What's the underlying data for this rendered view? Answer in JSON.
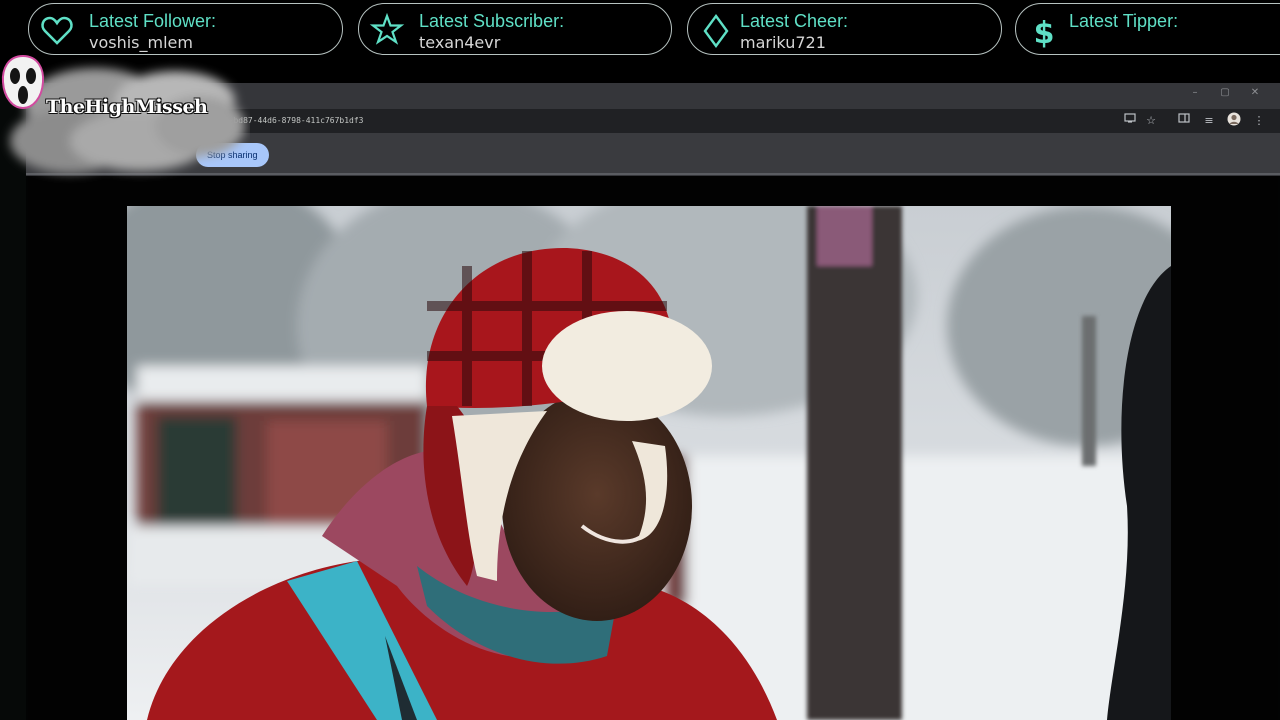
{
  "alerts": [
    {
      "icon": "heart-icon",
      "label": "Latest Follower:",
      "value": "voshis_mlem"
    },
    {
      "icon": "star-icon",
      "label": "Latest Subscriber:",
      "value": "texan4evr"
    },
    {
      "icon": "diamond-icon",
      "label": "Latest Cheer:",
      "value": "mariku721"
    },
    {
      "icon": "dollar-icon",
      "label": "Latest Tipper:",
      "value": ""
    }
  ],
  "colors": {
    "accent": "#5fe0c6",
    "pill_border": "#b6c2c0",
    "button": "#a8c7fa"
  },
  "streamer": {
    "name": "TheHighMisseh",
    "logo_icon": "ghostface-mask-icon"
  },
  "browser": {
    "url": "55-bd87-44d6-8798-411c767b1df3",
    "window_controls": [
      "–",
      "▢",
      "✕"
    ],
    "share_button": "Stop sharing",
    "toolbar_icons": [
      "cast-icon",
      "bookmark-star-icon",
      "sidepanel-icon",
      "media-icon",
      "profile-avatar",
      "menu-icon"
    ]
  },
  "video": {
    "description_icon": "video-frame"
  }
}
